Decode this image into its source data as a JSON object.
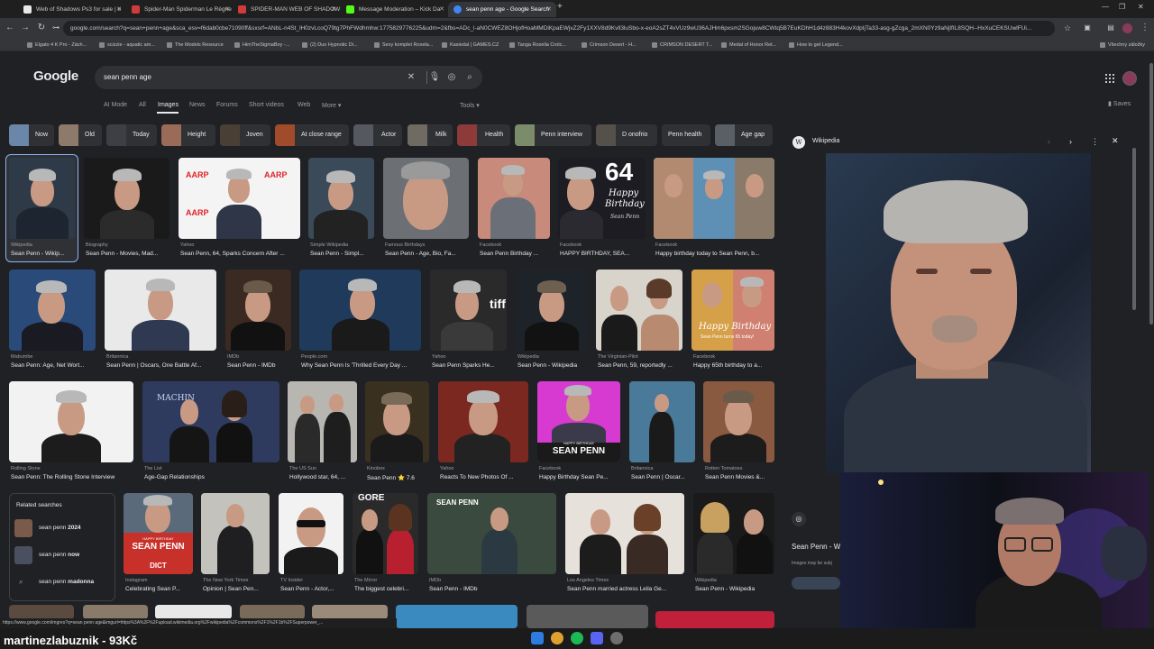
{
  "browser": {
    "tabs": [
      {
        "label": "Web of Shadows Ps3 for sale | e",
        "favicon": "#e8e8e8"
      },
      {
        "label": "Spider-Man Spiderman Le Règne",
        "favicon": "#d23b3b"
      },
      {
        "label": "SPIDER-MAN WEB OF SHADOW",
        "favicon": "#d23b3b"
      },
      {
        "label": "Message Moderation – Kick Da",
        "favicon": "#53fc18"
      },
      {
        "label": "sean penn age - Google Search",
        "favicon": "#4285f4"
      }
    ],
    "new_tab": "+",
    "url": "google.com/search?q=sean+penn+age&sca_esv=f6dab0cbe71090ff&sxsrf=ANbL-n4St_lH0zvLcoQ79tg7PhFWdhmhw:1775829776225&udm=2&fbs=ADc_l-aN0CWEZ8OHjofHoaMMDiKpaEWjvZ2Fy1XXV8d9Kvll3luSbo-x-eoA2sZT4vVUz9wU36AJHm6pxsm2SGojuw8CWtq5B7EuKDhH1d4z883H4kovXdpIjTa33-asg-gZcga_2mXN0Yz9aNjIfIL8SQH--HxXuCEKSUwlFUi...",
    "bookmarks": [
      "Elgato 4 K Pro - Zách...",
      "scizzie - aquatic am...",
      "The Models Resource",
      "HimTheSigmaBoy -...",
      "(2) Duo Hypnotic Di...",
      "Sexy komplet Roxela...",
      "Kasiedal | GAMES.CZ",
      "Tanga Roxelia Crotc...",
      "Crimson Desert - H...",
      "CRIMSON DESERT T...",
      "Medal of Honor Ret...",
      "How to get Legend..."
    ],
    "all_bookmarks": "Všechny záložky"
  },
  "google": {
    "logo": "Google",
    "query": "sean penn age",
    "nav_tabs": [
      "AI Mode",
      "All",
      "Images",
      "News",
      "Forums",
      "Short videos",
      "Web",
      "More"
    ],
    "tools": "Tools",
    "saves": "Saves",
    "chips": [
      "Now",
      "Old",
      "Today",
      "Height",
      "Joven",
      "At close range",
      "Actor",
      "Milk",
      "Health",
      "Penn interview",
      "D onofrio",
      "Penn health",
      "Age gap"
    ]
  },
  "results": [
    {
      "source": "Wikipedia",
      "title": "Sean Penn - Wikip..."
    },
    {
      "source": "Biography",
      "title": "Sean Penn - Movies, Mad..."
    },
    {
      "source": "Yahoo",
      "title": "Sean Penn, 64, Sparks Concern After ..."
    },
    {
      "source": "Simple Wikipedia",
      "title": "Sean Penn - Simpl..."
    },
    {
      "source": "Famous Birthdays",
      "title": "Sean Penn - Age, Bio, Fa..."
    },
    {
      "source": "Facebook",
      "title": "Sean Penn Birthday ..."
    },
    {
      "source": "Facebook",
      "title": "HAPPY BIRTHDAY, SEA..."
    },
    {
      "source": "Facebook",
      "title": "Happy birthday today to Sean Penn, b..."
    },
    {
      "source": "Mabumbe",
      "title": "Sean Penn: Age, Net Wort..."
    },
    {
      "source": "Britannica",
      "title": "Sean Penn | Oscars, One Battle Af..."
    },
    {
      "source": "IMDb",
      "title": "Sean Penn - IMDb"
    },
    {
      "source": "People.com",
      "title": "Why Sean Penn Is 'Thrilled Every Day ..."
    },
    {
      "source": "Yahoo",
      "title": "Sean Penn Sparks He..."
    },
    {
      "source": "Wikipedia",
      "title": "Sean Penn - Wikipedia"
    },
    {
      "source": "The Virginian-Pilot",
      "title": "Sean Penn, 59, reportedly ..."
    },
    {
      "source": "Facebook",
      "title": "Happy 65th birthday to a..."
    },
    {
      "source": "Rolling Stone",
      "title": "Sean Penn: The Rolling Stone Interview"
    },
    {
      "source": "The List",
      "title": "Age-Gap Relationships"
    },
    {
      "source": "The US Sun",
      "title": "Hollywood star, 64, ..."
    },
    {
      "source": "Kinobox",
      "title": "Sean Penn ⭐ 7.6"
    },
    {
      "source": "Yahoo",
      "title": "Reacts To New Photos Of ..."
    },
    {
      "source": "Facebook",
      "title": "Happy Birthday Sean Pe..."
    },
    {
      "source": "Britannica",
      "title": "Sean Penn | Oscar..."
    },
    {
      "source": "Rotten Tomatoes",
      "title": "Sean Penn Movies &..."
    },
    {
      "source": "Instagram",
      "title": "Celebrating Sean P..."
    },
    {
      "source": "The New York Times",
      "title": "Opinion | Sean Pen..."
    },
    {
      "source": "TV Insider",
      "title": "Sean Penn - Actor,..."
    },
    {
      "source": "The Mirror",
      "title": "The biggest celebri..."
    },
    {
      "source": "IMDb",
      "title": "Sean Penn - IMDb"
    },
    {
      "source": "Los Angeles Times",
      "title": "Sean Penn married actress Leila Ge..."
    },
    {
      "source": "Wikipedia",
      "title": "Sean Penn - Wikipedia"
    }
  ],
  "image_text": {
    "aarp": "AARP",
    "birthday_64": "64",
    "birthday_happy": "Happy",
    "birthday_word": "Birthday",
    "birthday_name": "Sean Penn",
    "happy_birthday_65": "Happy Birthday",
    "happy_birthday_65_sub": "Sean Penn turns 65 today!",
    "sean_penn_caps": "SEAN PENN",
    "happy_birthday_caps": "HAPPY BIRTHDAY",
    "dict": "DICT",
    "gore": "GORE"
  },
  "related": {
    "heading": "Related searches",
    "items": [
      {
        "prefix": "sean penn ",
        "bold": "2024"
      },
      {
        "prefix": "sean penn ",
        "bold": "now"
      },
      {
        "prefix": "sean penn ",
        "bold": "madonna"
      }
    ]
  },
  "panel": {
    "source": "Wikipedia",
    "title": "Sean Penn - W",
    "note": "Images may be subj"
  },
  "status_url": "https://www.google.com/imgres?q=sean penn age&imgurl=https%3A%2F%2Fupload.wikimedia.org%2Fwikipedia%2Fcommons%2F1%2F1b%2FSuperpower_...",
  "overlay_name": "martinezlabuznik - 93Kč"
}
